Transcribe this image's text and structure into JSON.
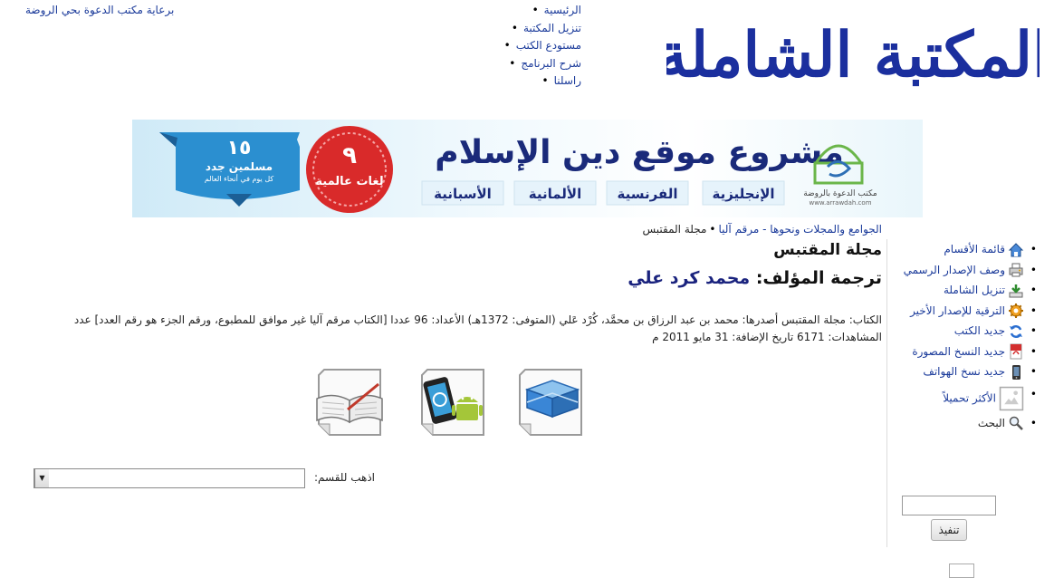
{
  "header": {
    "logo_text": "المكتبة الشاملة",
    "sponsor": "برعاية مكتب الدعوة بحي الروضة",
    "nav": [
      "الرئيسية",
      "تنزيل المكتبة",
      "مستودع الكتب",
      "شرح البرنامج",
      "راسلنا"
    ]
  },
  "banner": {
    "title": "مشروع موقع دين الإسلام",
    "languages": [
      "الإنجليزية",
      "الفرنسية",
      "الألمانية",
      "الأسبانية"
    ],
    "badge_number": "٩",
    "badge_text": "لغات عالمية",
    "ribbon_number": "١٥",
    "ribbon_text": "مسلمين جدد",
    "ribbon_sub": "كل يوم في أنحاء العالم",
    "org_name": "مكتب الدعوة بالروضة",
    "org_url": "www.arrawdah.com"
  },
  "breadcrumb": {
    "parent": "الجوامع والمجلات ونحوها - مرقم آليا",
    "separator": "•",
    "current": "مجلة المقتبس"
  },
  "book": {
    "title": "مجلة المقتبس",
    "author_label": "ترجمة المؤلف:",
    "author_name": "محمد كرد علي",
    "meta_line1": "الكتاب: مجلة المقتبس أصدرها: محمد بن عبد الرزاق بن محمَّد، كُرْد عَلي (المتوفى: 1372هـ) الأعداد: 96 عددا    [الكتاب مرقم آليا غير موافق للمطبوع، ورقم الجزء هو رقم العدد] عدد",
    "meta_line2": "المشاهدات: 6171 تاريخ الإضافة: 31 مايو 2011 م"
  },
  "jump": {
    "label": "اذهب للقسم:",
    "selected": ""
  },
  "sidebar": {
    "items": [
      {
        "label": "قائمة الأقسام",
        "icon": "home-icon"
      },
      {
        "label": "وصف الإصدار الرسمي",
        "icon": "printer-icon"
      },
      {
        "label": "تنزيل الشاملة",
        "icon": "download-icon"
      },
      {
        "label": "الترقية للإصدار الأخير",
        "icon": "gear-icon"
      },
      {
        "label": "جديد الكتب",
        "icon": "refresh-icon"
      },
      {
        "label": "جديد النسخ المصورة",
        "icon": "pdf-icon"
      },
      {
        "label": "جديد نسخ الهواتف",
        "icon": "phone-icon"
      },
      {
        "label": "الأكثر تحميلاً",
        "icon": "image-icon"
      },
      {
        "label": "البحث",
        "icon": "search-icon"
      }
    ],
    "search_placeholder": "",
    "search_button": "تنفيذ"
  }
}
